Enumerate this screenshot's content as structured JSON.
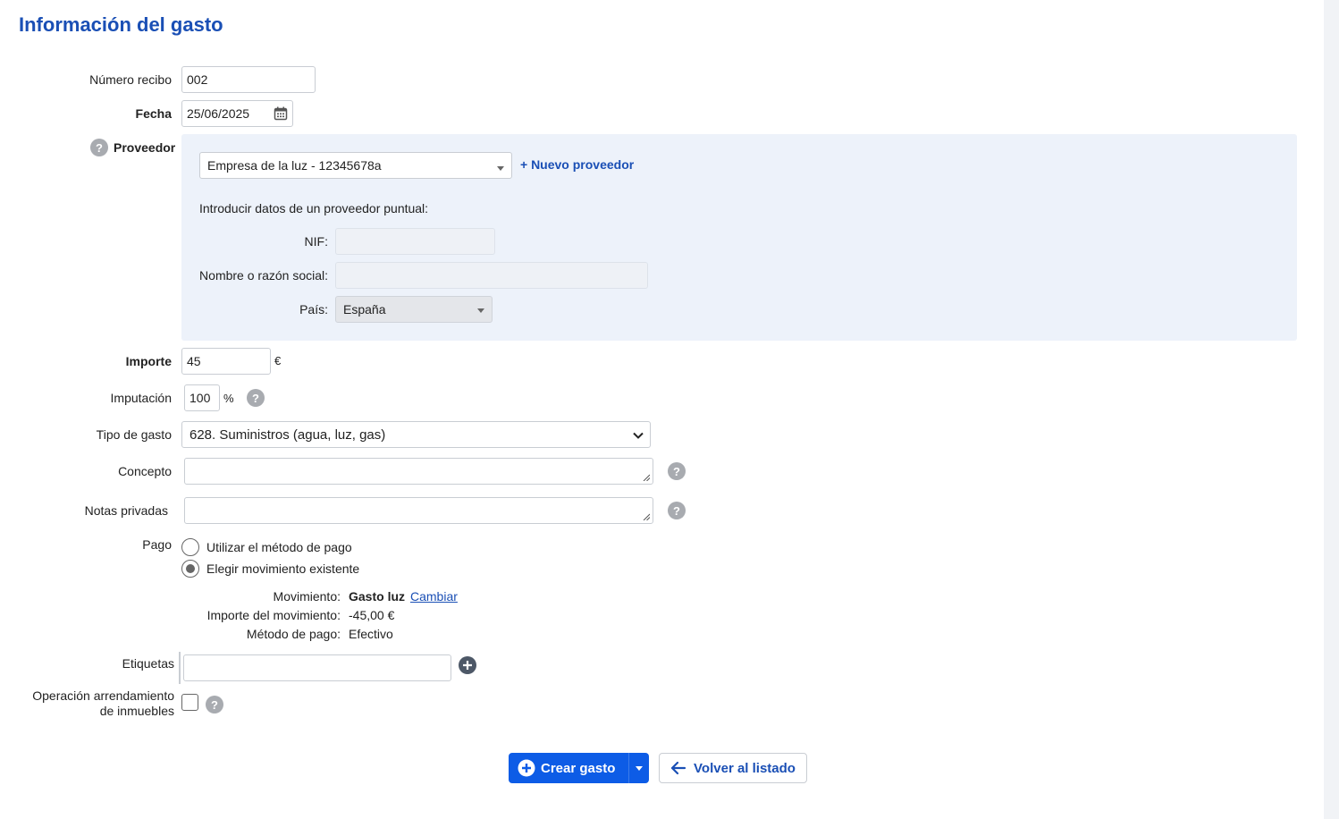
{
  "page": {
    "title": "Información del gasto"
  },
  "form": {
    "receipt": {
      "label": "Número recibo",
      "value": "002"
    },
    "date": {
      "label": "Fecha",
      "value": "25/06/2025"
    },
    "provider": {
      "label": "Proveedor",
      "selected": "Empresa de la luz - 12345678a",
      "new_link": "+ Nuevo proveedor",
      "oneoff_heading": "Introducir datos de un proveedor puntual:",
      "nif_label": "NIF:",
      "nif_value": "",
      "name_label": "Nombre o razón social:",
      "name_value": "",
      "country_label": "País:",
      "country_value": "España"
    },
    "amount": {
      "label": "Importe",
      "value": "45",
      "unit": "€"
    },
    "imputation": {
      "label": "Imputación",
      "value": "100",
      "unit": "%"
    },
    "expense_type": {
      "label": "Tipo de gasto",
      "value": "628. Suministros (agua, luz, gas)"
    },
    "concept": {
      "label": "Concepto",
      "value": ""
    },
    "private_notes": {
      "label": "Notas privadas",
      "value": ""
    },
    "payment": {
      "label": "Pago",
      "options": [
        "Utilizar el método de pago",
        "Elegir movimiento existente"
      ],
      "selected_index": 1,
      "movement_label": "Movimiento:",
      "movement_value": "Gasto luz",
      "change_link": "Cambiar",
      "movement_amount_label": "Importe del movimiento:",
      "movement_amount_value": "-45,00 €",
      "payment_method_label": "Método de pago:",
      "payment_method_value": "Efectivo"
    },
    "tags": {
      "label": "Etiquetas",
      "value": ""
    },
    "lease": {
      "label_line1": "Operación arrendamiento",
      "label_line2": "de inmuebles",
      "checked": false
    }
  },
  "actions": {
    "create": "Crear gasto",
    "back": "Volver al listado"
  },
  "icons": {
    "help": "?",
    "calendar": "calendar-icon",
    "add": "plus-circle-icon"
  },
  "colors": {
    "accent": "#1a4fb5",
    "primary_button": "#0d5ce6",
    "panel": "#edf2fa"
  }
}
